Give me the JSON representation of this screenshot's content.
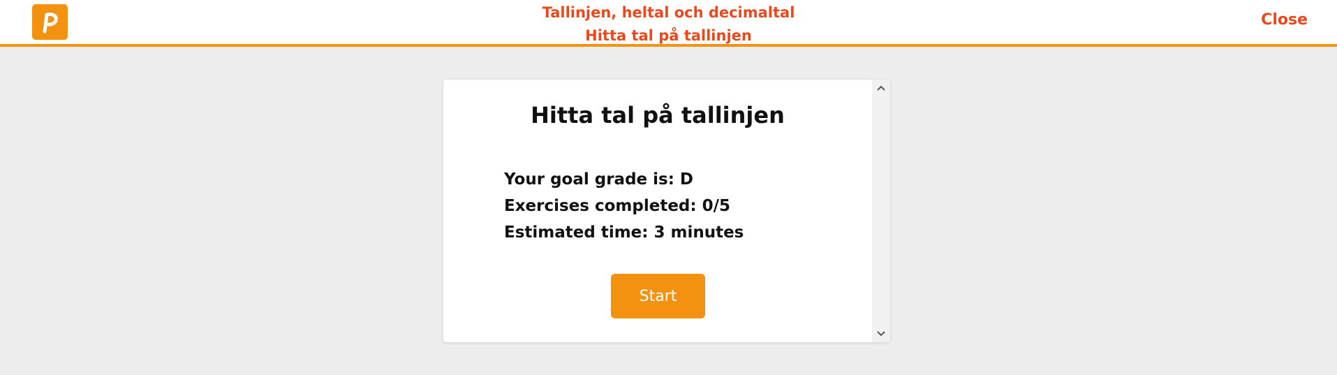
{
  "header": {
    "logo_icon": "p-logo-icon",
    "title": "Tallinjen, heltal och decimaltal",
    "subtitle": "Hitta tal på tallinjen",
    "close_label": "Close"
  },
  "card": {
    "title": "Hitta tal på tallinjen",
    "goal_grade": "Your goal grade is: D",
    "exercises_completed": "Exercises completed: 0/5",
    "estimated_time": "Estimated time: 3 minutes",
    "start_label": "Start"
  },
  "colors": {
    "accent": "#f39110",
    "title_red": "#e84a1e",
    "background": "#ededed"
  }
}
